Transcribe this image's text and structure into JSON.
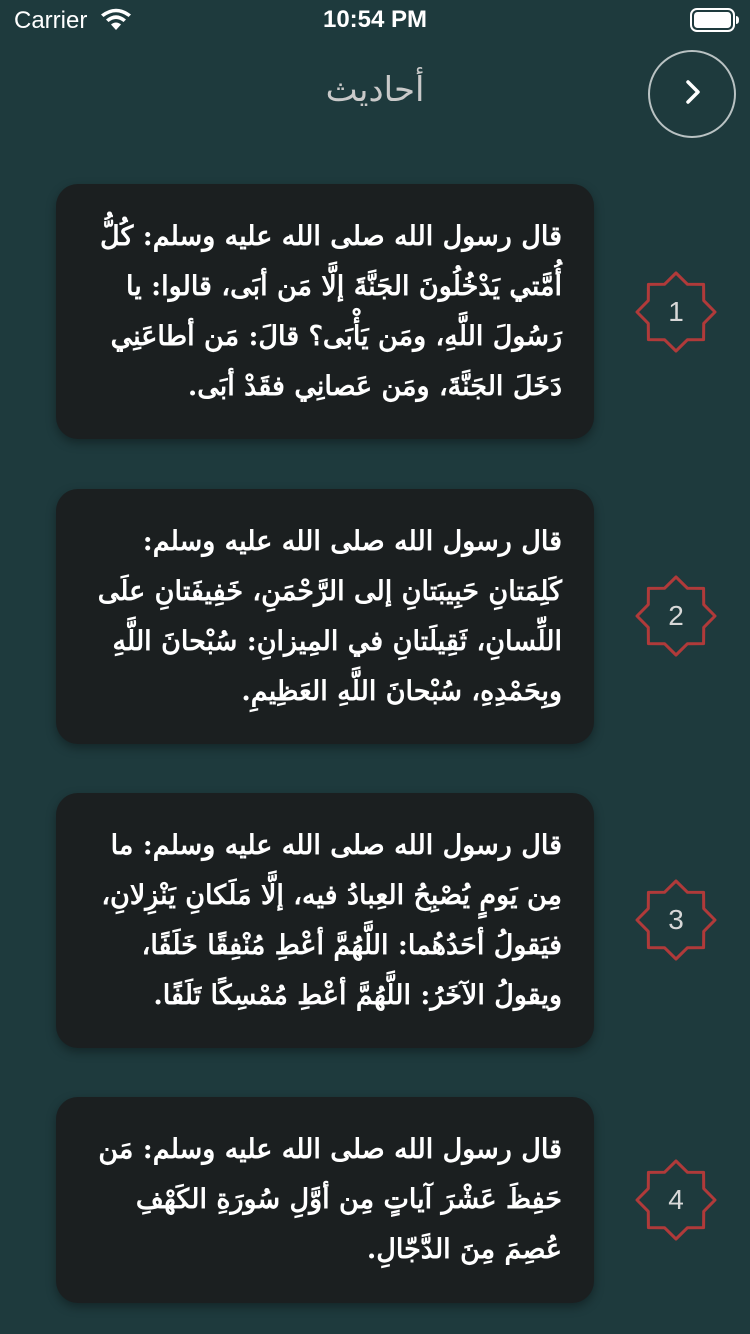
{
  "status_bar": {
    "carrier": "Carrier",
    "time": "10:54 PM"
  },
  "nav": {
    "title": "أحاديث",
    "back_icon": "chevron-right-icon"
  },
  "colors": {
    "background": "#1e3a3d",
    "card": "#1b1f20",
    "badge_stroke": "#b03a3a",
    "title": "#c9c9c9"
  },
  "hadiths": [
    {
      "number": "1",
      "text": "قال رسول الله صلى الله عليه وسلم: كُلُّ أُمَّتي يَدْخُلُونَ الجَنَّةَ إلَّا مَن أبَى، قالوا: يا رَسُولَ اللَّهِ، ومَن يَأْبَى؟ قالَ: مَن أطاعَنِي دَخَلَ الجَنَّةَ، ومَن عَصانِي فقَدْ أبَى."
    },
    {
      "number": "2",
      "text": "قال رسول الله صلى الله عليه وسلم: كَلِمَتانِ حَبِيبَتانِ إلى الرَّحْمَنِ، خَفِيفَتانِ علَى اللِّسانِ، ثَقِيلَتانِ في المِيزانِ: سُبْحانَ اللَّهِ وبِحَمْدِهِ، سُبْحانَ اللَّهِ العَظِيمِ."
    },
    {
      "number": "3",
      "text": "قال رسول الله صلى الله عليه وسلم: ما مِن يَومٍ يُصْبِحُ العِبادُ فيه، إلَّا مَلَكانِ يَنْزِلانِ، فيَقولُ أحَدُهُما: اللَّهُمَّ أعْطِ مُنْفِقًا خَلَفًا، ويقولُ الآخَرُ: اللَّهُمَّ أعْطِ مُمْسِكًا تَلَفًا."
    },
    {
      "number": "4",
      "text": "قال رسول الله صلى الله عليه وسلم: مَن حَفِظَ عَشْرَ آياتٍ مِن أوَّلِ سُورَةِ الكَهْفِ عُصِمَ مِنَ الدَّجّالِ."
    }
  ]
}
